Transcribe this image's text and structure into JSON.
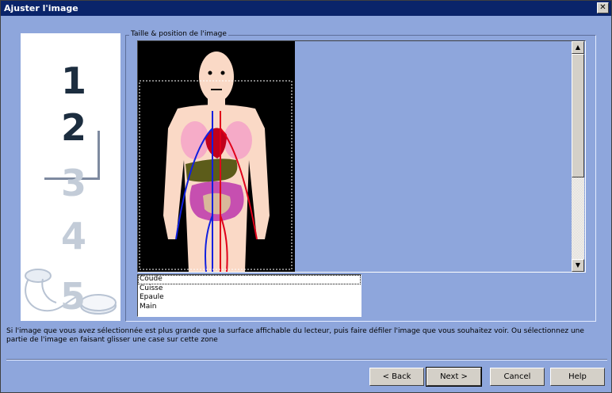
{
  "window": {
    "title": "Ajuster l'image",
    "close_glyph": "✕"
  },
  "wizard_steps": [
    {
      "number": "1",
      "state": "done"
    },
    {
      "number": "2",
      "state": "current"
    },
    {
      "number": "3",
      "state": "todo"
    },
    {
      "number": "4",
      "state": "todo"
    },
    {
      "number": "5",
      "state": "todo"
    }
  ],
  "groupbox": {
    "label": "Taille & position de l'image"
  },
  "image_list": {
    "items": [
      "Coude",
      "Cuisse",
      "Epaule",
      "Main"
    ],
    "selected": "Coude"
  },
  "instructions": "Si l'image que vous avez sélectionnée est plus grande que la surface affichable du lecteur, puis faire défiler l'image que vous souhaitez voir. Ou sélectionnez une partie de l'image en faisant glisser une case sur cette zone",
  "buttons": {
    "back": "< Back",
    "next": "Next >",
    "cancel": "Cancel",
    "help": "Help"
  },
  "colors": {
    "background": "#8ea6dc",
    "titlebar": "#0a246a",
    "button_face": "#d4d0c8"
  }
}
